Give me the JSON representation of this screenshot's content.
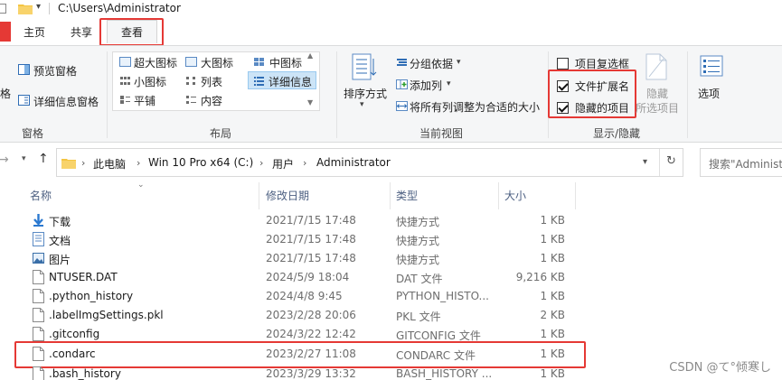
{
  "window": {
    "title": "C:\\Users\\Administrator"
  },
  "tabs": [
    {
      "label": "主页"
    },
    {
      "label": "共享"
    },
    {
      "label": "查看"
    }
  ],
  "ribbon": {
    "pane": {
      "nav_label": "格",
      "preview_label": "预览窗格",
      "details_label": "详细信息窗格",
      "group_label": "窗格"
    },
    "layout": {
      "extra_large": "超大图标",
      "large": "大图标",
      "medium": "中图标",
      "small": "小图标",
      "list": "列表",
      "details": "详细信息",
      "tiles": "平铺",
      "content": "内容",
      "group_label": "布局"
    },
    "current_view": {
      "sort_label": "排序方式",
      "group_by": "分组依据",
      "add_columns": "添加列",
      "fit_columns": "将所有列调整为合适的大小",
      "group_label": "当前视图"
    },
    "show_hide": {
      "item_checkboxes": "项目复选框",
      "file_extensions": "文件扩展名",
      "hidden_items": "隐藏的项目",
      "hide_selected_line1": "隐藏",
      "hide_selected_line2": "所选项目",
      "group_label": "显示/隐藏",
      "item_checkboxes_checked": false,
      "file_extensions_checked": true,
      "hidden_items_checked": true
    },
    "options": {
      "label": "选项"
    }
  },
  "address": {
    "crumbs": [
      "此电脑",
      "Win 10 Pro x64 (C:)",
      "用户",
      "Administrator"
    ],
    "search_placeholder": "搜索\"Administrat"
  },
  "columns": {
    "name": "名称",
    "date": "修改日期",
    "type": "类型",
    "size": "大小"
  },
  "files": [
    {
      "name": "下载",
      "date": "2021/7/15 17:48",
      "type": "快捷方式",
      "size": "1 KB",
      "icon": "download-icon"
    },
    {
      "name": "文档",
      "date": "2021/7/15 17:48",
      "type": "快捷方式",
      "size": "1 KB",
      "icon": "document-icon"
    },
    {
      "name": "图片",
      "date": "2021/7/15 17:48",
      "type": "快捷方式",
      "size": "1 KB",
      "icon": "picture-icon"
    },
    {
      "name": "NTUSER.DAT",
      "date": "2024/5/9 18:04",
      "type": "DAT 文件",
      "size": "9,216 KB",
      "icon": "file-icon"
    },
    {
      "name": ".python_history",
      "date": "2024/4/8 9:45",
      "type": "PYTHON_HISTO...",
      "size": "1 KB",
      "icon": "file-icon"
    },
    {
      "name": ".labelImgSettings.pkl",
      "date": "2023/2/28 20:06",
      "type": "PKL 文件",
      "size": "2 KB",
      "icon": "file-icon"
    },
    {
      "name": ".gitconfig",
      "date": "2024/3/22 12:42",
      "type": "GITCONFIG 文件",
      "size": "1 KB",
      "icon": "file-icon"
    },
    {
      "name": ".condarc",
      "date": "2023/2/27 11:08",
      "type": "CONDARC 文件",
      "size": "1 KB",
      "icon": "file-icon"
    },
    {
      "name": ".bash_history",
      "date": "2023/3/29 13:32",
      "type": "BASH_HISTORY ...",
      "size": "1 KB",
      "icon": "file-icon"
    }
  ],
  "watermark": "CSDN @て°倾寒し",
  "colors": {
    "highlight": "#e53935",
    "ribbon_bg": "#f5f6f7",
    "folder": "#f4c542"
  }
}
